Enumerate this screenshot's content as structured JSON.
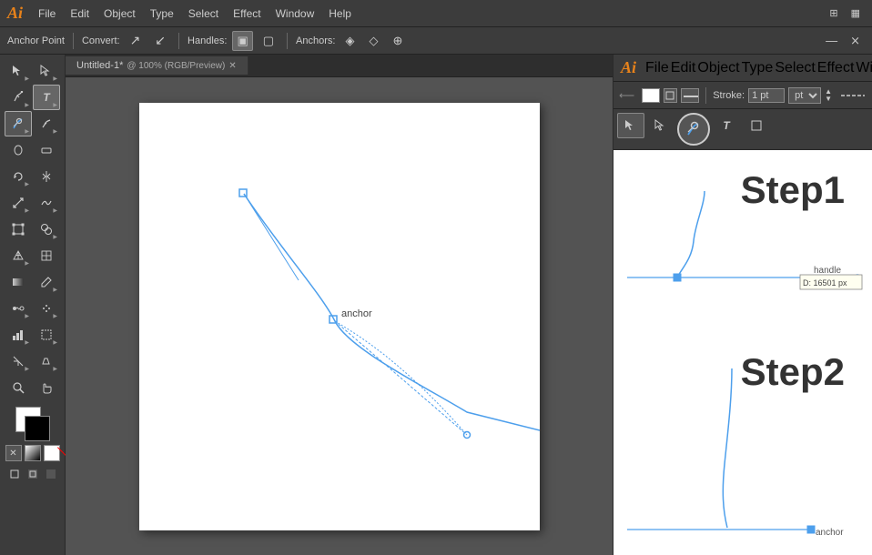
{
  "app": {
    "logo": "Ai",
    "menus_left": [
      "File",
      "Edit",
      "Object",
      "Type",
      "Select",
      "Effect",
      "Window",
      "Help"
    ],
    "menus_right": [
      "File",
      "Edit",
      "Object",
      "Type",
      "Select",
      "Effect",
      "Window"
    ]
  },
  "toolbar": {
    "anchor_point_label": "Anchor Point",
    "convert_label": "Convert:",
    "handles_label": "Handles:",
    "anchors_label": "Anchors:"
  },
  "tab": {
    "title": "Untitled-1*",
    "subtitle": "@ 100% (RGB/Preview)"
  },
  "right_panel": {
    "stroke_label": "Stroke:",
    "stroke_value": "1 pt"
  },
  "steps": [
    {
      "id": "step1",
      "label": "Step1"
    },
    {
      "id": "step2",
      "label": "Step2"
    }
  ],
  "annotations": {
    "anchor": "anchor",
    "handle": "handle",
    "anchor2": "anchor",
    "distance": "D: 16501 px"
  },
  "tools": [
    "select",
    "direct-select",
    "pen",
    "type",
    "pencil",
    "rectangle",
    "rotate",
    "reflect",
    "scale",
    "warp",
    "free-transform",
    "shape-builder",
    "perspective-grid",
    "mesh",
    "gradient",
    "eyedropper",
    "blend",
    "symbol-sprayer",
    "column-graph",
    "artboard",
    "slice",
    "eraser",
    "zoom",
    "hand"
  ]
}
